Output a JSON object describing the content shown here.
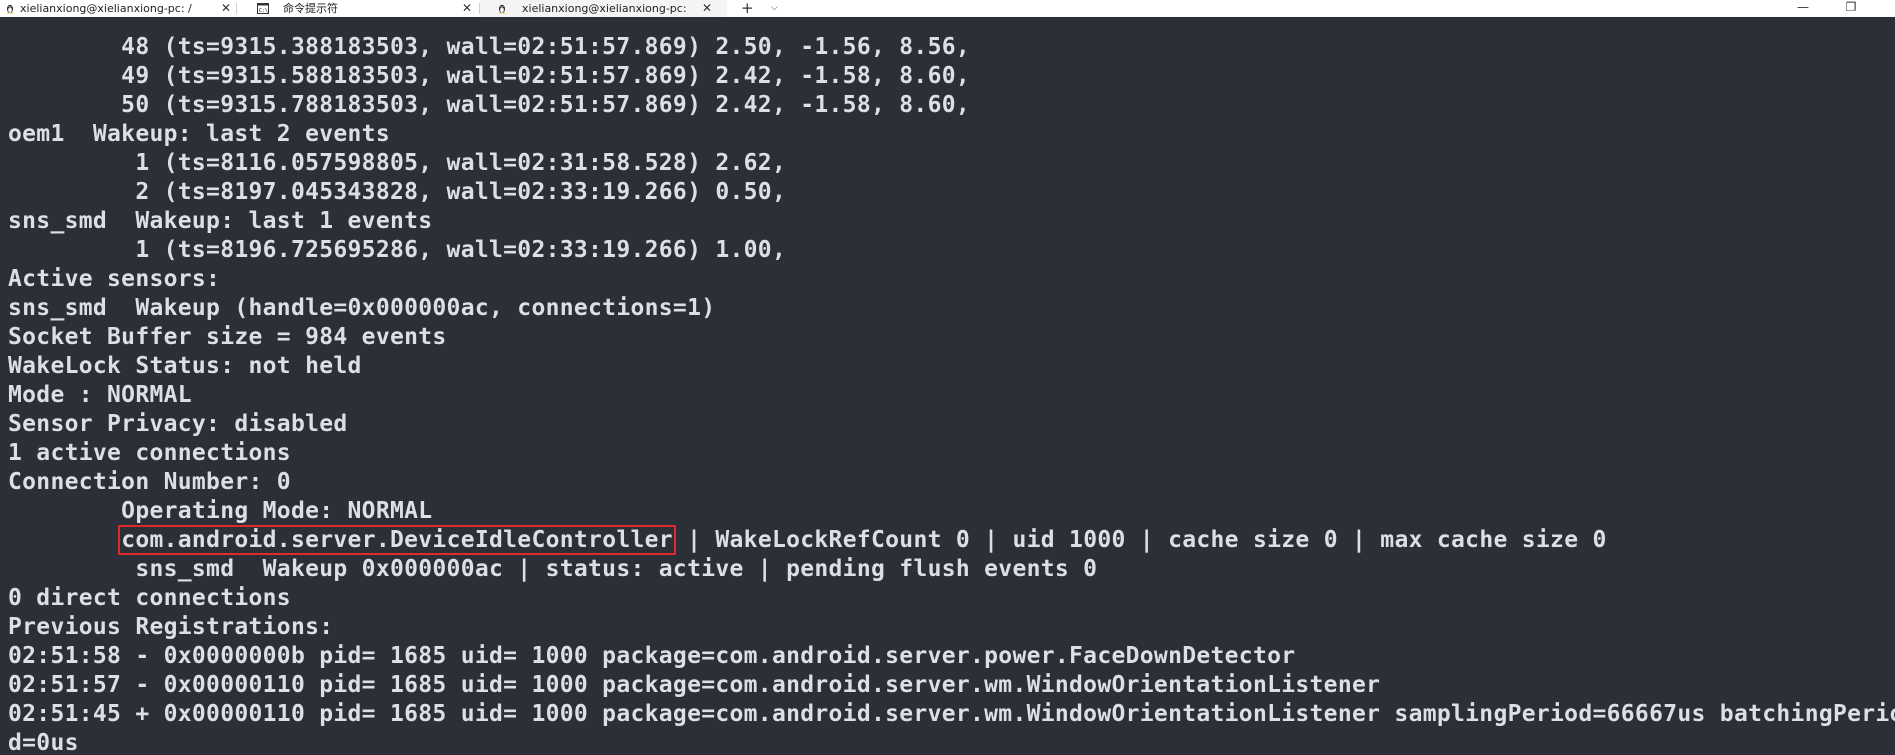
{
  "tabs": [
    {
      "label": "xielianxiong@xielianxiong-pc: /",
      "icon": "linux-penguin-icon"
    },
    {
      "label": "命令提示符",
      "icon": "cmd-icon"
    },
    {
      "label": "xielianxiong@xielianxiong-pc:",
      "icon": "linux-penguin-icon"
    }
  ],
  "tabbar": {
    "close_glyph": "✕",
    "new_tab_glyph": "+",
    "dropdown_glyph": "⌵",
    "minimize_glyph": "—",
    "restore_glyph": "❐"
  },
  "terminal": {
    "lines": [
      "        48 (ts=9315.388183503, wall=02:51:57.869) 2.50, -1.56, 8.56,",
      "        49 (ts=9315.588183503, wall=02:51:57.869) 2.42, -1.58, 8.60,",
      "        50 (ts=9315.788183503, wall=02:51:57.869) 2.42, -1.58, 8.60,",
      "oem1  Wakeup: last 2 events",
      "         1 (ts=8116.057598805, wall=02:31:58.528) 2.62,",
      "         2 (ts=8197.045343828, wall=02:33:19.266) 0.50,",
      "sns_smd  Wakeup: last 1 events",
      "         1 (ts=8196.725695286, wall=02:33:19.266) 1.00,",
      "Active sensors:",
      "sns_smd  Wakeup (handle=0x000000ac, connections=1)",
      "Socket Buffer size = 984 events",
      "WakeLock Status: not held",
      "Mode : NORMAL",
      "Sensor Privacy: disabled",
      "1 active connections",
      "Connection Number: 0",
      "        Operating Mode: NORMAL"
    ],
    "highlight_line": {
      "indent": "        ",
      "highlighted": "com.android.server.DeviceIdleController",
      "rest": " | WakeLockRefCount 0 | uid 1000 | cache size 0 | max cache size 0"
    },
    "lines_after": [
      "         sns_smd  Wakeup 0x000000ac | status: active | pending flush events 0",
      "0 direct connections",
      "Previous Registrations:",
      "02:51:58 - 0x0000000b pid= 1685 uid= 1000 package=com.android.server.power.FaceDownDetector",
      "02:51:57 - 0x00000110 pid= 1685 uid= 1000 package=com.android.server.wm.WindowOrientationListener",
      "02:51:45 + 0x00000110 pid= 1685 uid= 1000 package=com.android.server.wm.WindowOrientationListener samplingPeriod=66667us batchingPerio",
      "d=0us"
    ],
    "colors": {
      "background": "#2b2f37",
      "foreground": "#dcdfe4",
      "highlight_box": "#e3282d"
    }
  }
}
